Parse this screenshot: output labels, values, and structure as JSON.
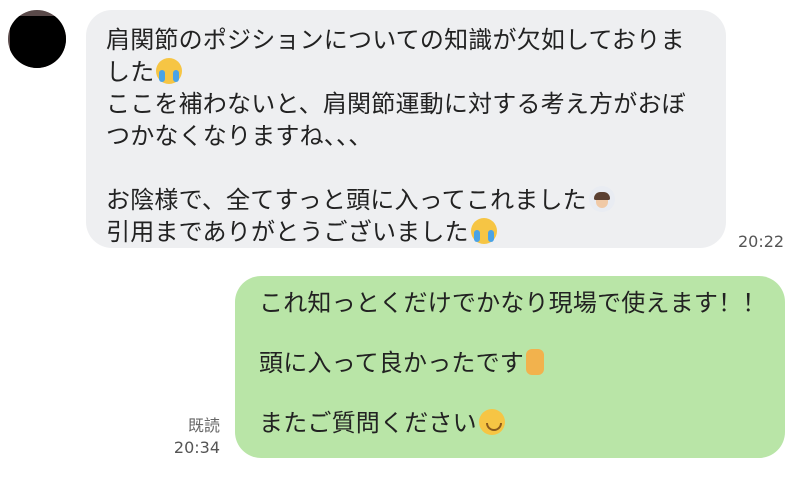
{
  "incoming": {
    "lines": [
      "肩関節のポジションについての知識が欠如しておりま",
      "した",
      "ここを補わないと、肩関節運動に対する考え方がおぼ",
      "つかなくなりますね、、、",
      "",
      "お陰様で、全てすっと頭に入ってこれました",
      "引用までありがとうございました"
    ],
    "time": "20:22",
    "emojis": [
      "crying-face",
      "person-bowing",
      "crying-face"
    ]
  },
  "outgoing": {
    "lines": [
      "これ知っとくだけでかなり現場で使えます！！",
      "",
      "頭に入って良かったです",
      "",
      "またご質問ください"
    ],
    "read_label": "既読",
    "time": "20:34",
    "emojis": [
      "thumbs-up",
      "smiling-face"
    ]
  }
}
